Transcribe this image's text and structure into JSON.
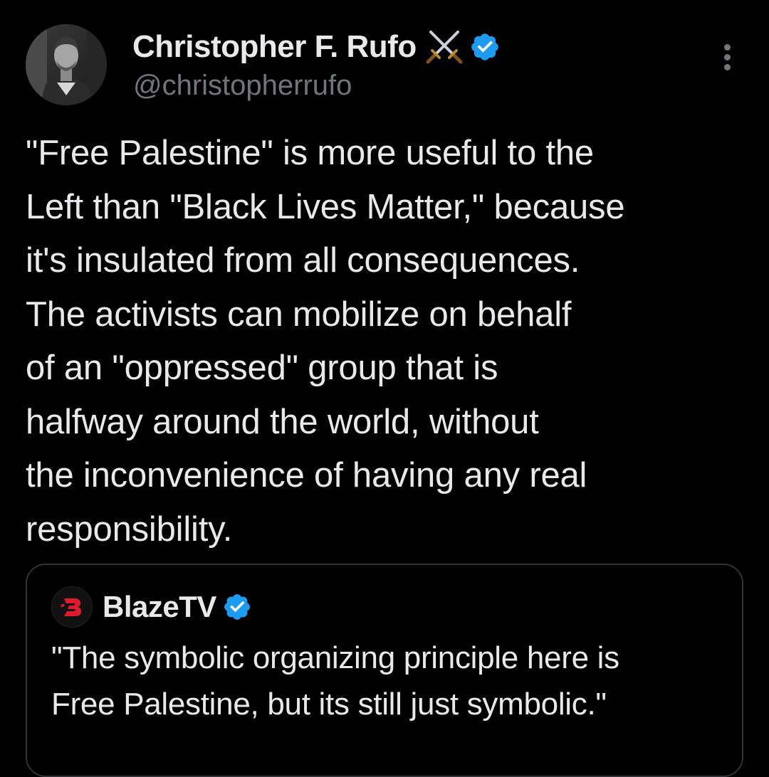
{
  "author": {
    "display_name": "Christopher F. Rufo",
    "handle": "@christopherrufo",
    "emoji_icon": "crossed-swords-icon",
    "verified": true,
    "verified_color": "#1d9bf0"
  },
  "tweet": {
    "text": "\"Free Palestine\" is more useful to the\nLeft than \"Black Lives Matter,\" because\nit's insulated from all consequences.\nThe activists can mobilize on behalf\nof an \"oppressed\" group that is\nhalfway around the world, without\nthe inconvenience of having any real\nresponsibility."
  },
  "quote": {
    "display_name": "BlazeTV",
    "avatar_icon": "blaze-logo-icon",
    "logo_color": "#e0192b",
    "verified": true,
    "text": "\"The symbolic organizing principle here is\nFree Palestine, but its still just symbolic.\""
  },
  "colors": {
    "background": "#000000",
    "primary_text": "#e7e9ea",
    "secondary_text": "#71767b",
    "border": "#2f3336"
  }
}
